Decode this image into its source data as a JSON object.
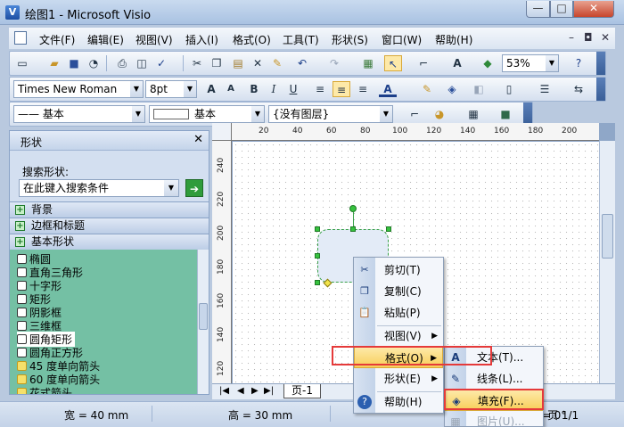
{
  "window": {
    "title": "绘图1 - Microsoft Visio",
    "app_icon_glyph": "V",
    "min_glyph": "—",
    "max_glyph": "□",
    "close_glyph": "✕"
  },
  "menubar": {
    "items": [
      "文件(F)",
      "编辑(E)",
      "视图(V)",
      "插入(I)",
      "格式(O)",
      "工具(T)",
      "形状(S)",
      "窗口(W)",
      "帮助(H)"
    ],
    "mdi_min": "–",
    "mdi_restore": "◘",
    "mdi_close": "✕"
  },
  "toolbar_standard": {
    "zoom": "53%"
  },
  "toolbar_format": {
    "font": "Times New Roman",
    "size": "8pt"
  },
  "toolbar_lines": {
    "line_style": "基本",
    "fill_style": "基本",
    "layer": "{没有图层}"
  },
  "shapes_panel": {
    "title": "形状",
    "close": "✕",
    "search_label": "搜索形状:",
    "search_placeholder": "在此键入搜索条件",
    "go_glyph": "➔",
    "stencils": [
      "背景",
      "边框和标题",
      "基本形状"
    ],
    "items": [
      "椭圆",
      "直角三角形",
      "十字形",
      "矩形",
      "阴影框",
      "三维框",
      "圆角矩形",
      "圆角正方形",
      "45 度单向箭头",
      "60 度单向箭头",
      "花式箭头"
    ]
  },
  "ruler": {
    "h": [
      "20",
      "40",
      "60",
      "80",
      "100",
      "120",
      "140",
      "160",
      "180",
      "200"
    ],
    "v": [
      "240",
      "220",
      "200",
      "180",
      "160",
      "140",
      "120"
    ]
  },
  "page_tabs": {
    "tab": "页-1",
    "nav": [
      "|◀",
      "◀",
      "▶",
      "▶|"
    ]
  },
  "status": {
    "width": "宽 = 40 mm",
    "height": "高 = 30 mm",
    "angle": "角度 = 0°",
    "page": "页 1/1"
  },
  "context_menu": {
    "items": [
      {
        "label": "剪切(T)",
        "icon": "scissors-icon",
        "glyph": "✂"
      },
      {
        "label": "复制(C)",
        "icon": "copy-icon",
        "glyph": "❐"
      },
      {
        "label": "粘贴(P)",
        "icon": "paste-icon",
        "glyph": "📋"
      },
      {
        "label": "视图(V)",
        "icon": "",
        "glyph": ""
      },
      {
        "label": "格式(O)",
        "icon": "",
        "glyph": ""
      },
      {
        "label": "形状(E)",
        "icon": "",
        "glyph": ""
      },
      {
        "label": "帮助(H)",
        "icon": "help-icon",
        "glyph": "?"
      }
    ],
    "submenu_arrow": "▶"
  },
  "format_submenu": {
    "items": [
      {
        "label": "文本(T)...",
        "glyph": "A"
      },
      {
        "label": "线条(L)...",
        "glyph": "✎"
      },
      {
        "label": "填充(F)...",
        "glyph": "◈"
      },
      {
        "label": "图片(U)...",
        "glyph": "▦"
      }
    ]
  },
  "colors": {
    "highlight_box": "#e53a3a",
    "selection_green": "#37c23f",
    "stencil_bg": "#74c0a4"
  }
}
